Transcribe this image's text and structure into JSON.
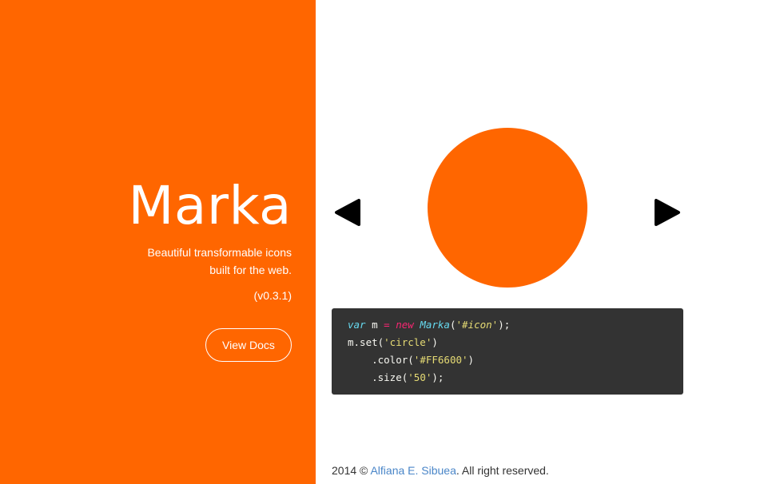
{
  "hero": {
    "title": "Marka",
    "tagline_line1": "Beautiful transformable icons",
    "tagline_line2": "built for the web.",
    "version": "(v0.3.1)",
    "docs_button": "View Docs",
    "background_color": "#ff6600"
  },
  "demo": {
    "prev_icon": "triangle-left",
    "next_icon": "triangle-right",
    "shape": "circle",
    "shape_color": "#FF6600",
    "code": {
      "line1": {
        "kw": "var",
        "var": " m ",
        "op": "=",
        "sp": " ",
        "new": "new",
        "sp2": " ",
        "cls": "Marka",
        "open": "(",
        "arg": "'#icon'",
        "close": ");"
      },
      "line2": {
        "call": "m.set(",
        "arg": "'circle'",
        "close": ")"
      },
      "line3": {
        "indent": "    ",
        "call": ".color(",
        "arg": "'#FF6600'",
        "close": ")"
      },
      "line4": {
        "indent": "    ",
        "call": ".size(",
        "arg": "'50'",
        "close": ");"
      }
    }
  },
  "footer": {
    "prefix": "2014 © ",
    "author": "Alfiana E. Sibuea",
    "suffix": ". All right reserved.",
    "link_color": "#4a86c8"
  }
}
